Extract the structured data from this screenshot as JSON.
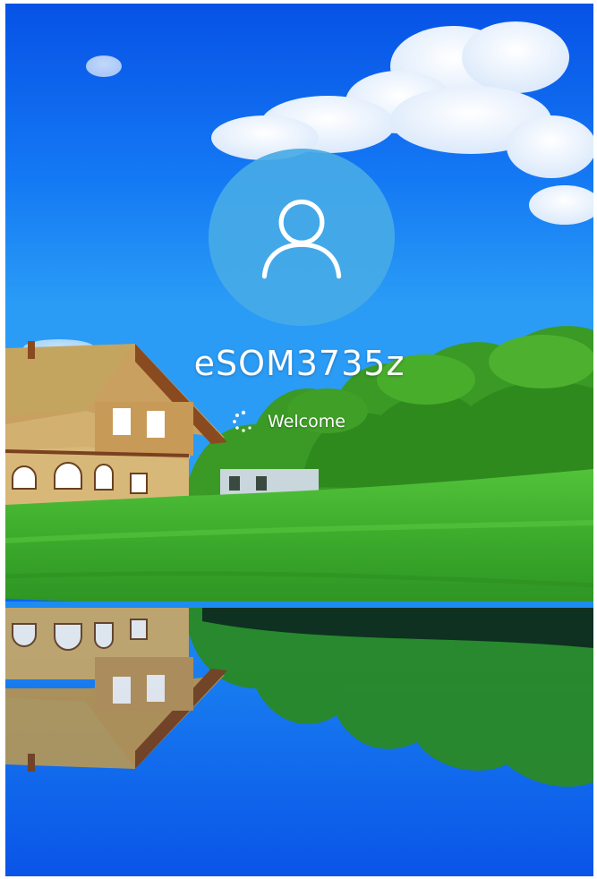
{
  "login": {
    "username": "eSOM3735z",
    "status": "Welcome"
  },
  "icons": {
    "avatar": "user-icon",
    "status": "loading-spinner-icon"
  },
  "colors": {
    "sky": "#0a64f0",
    "avatar_circle": "#46aae6",
    "text": "#ffffff",
    "grass": "#3fae2a"
  }
}
